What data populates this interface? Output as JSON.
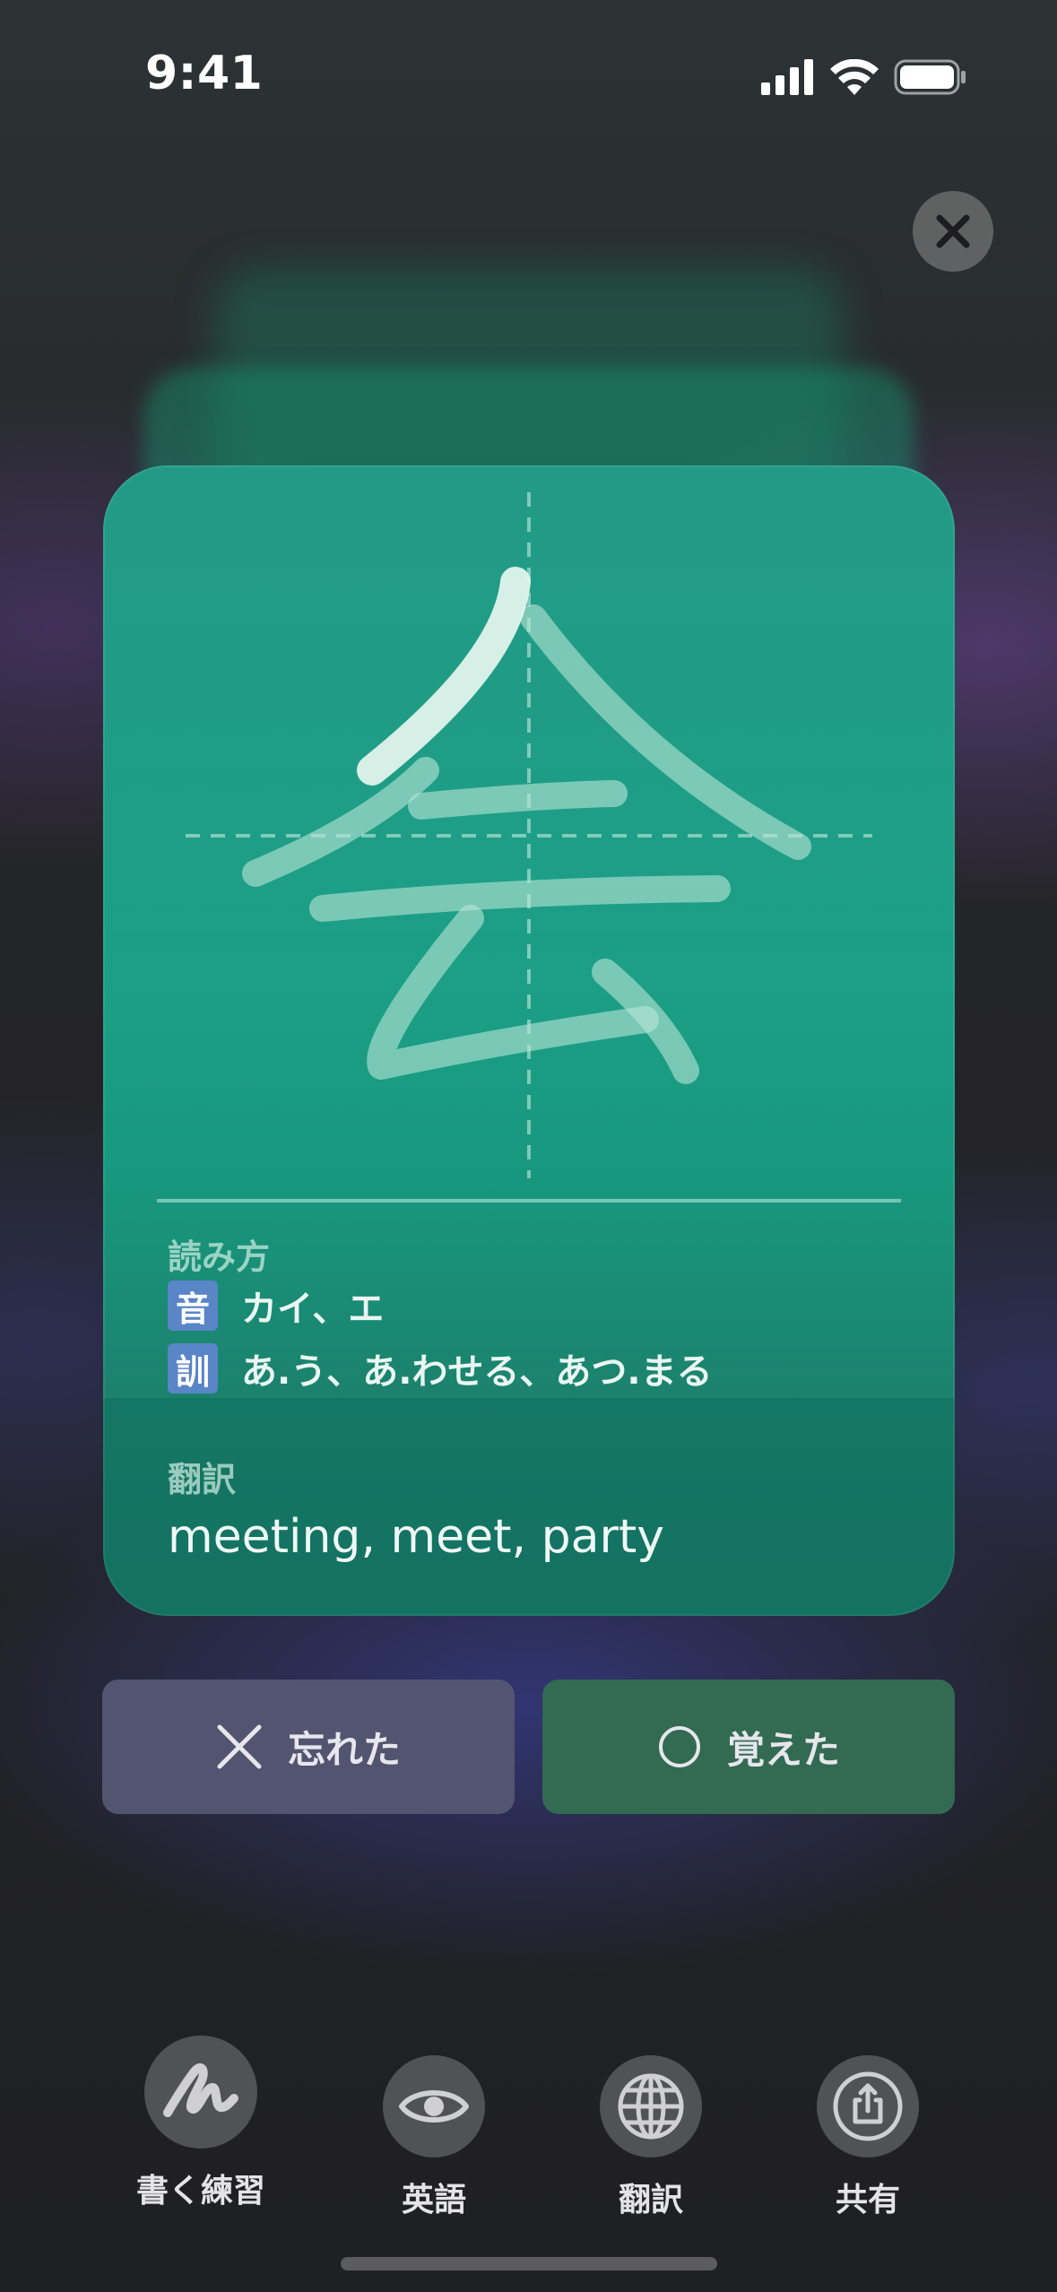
{
  "status_bar": {
    "time": "9:41",
    "icons": [
      "cellular-signal-icon",
      "wifi-icon",
      "battery-icon"
    ]
  },
  "close_button": {
    "icon": "close-icon"
  },
  "card": {
    "kanji": "会",
    "reading_title": "読み方",
    "on_badge": "音",
    "on_reading": "カイ、エ",
    "kun_badge": "訓",
    "kun_reading": "あ.う、あ.わせる、あつ.まる",
    "translation_title": "翻訳",
    "translation": "meeting, meet, party"
  },
  "actions": {
    "forgot_label": "忘れた",
    "forgot_icon": "cross-icon",
    "remembered_label": "覚えた",
    "remembered_icon": "circle-icon"
  },
  "toolbar": [
    {
      "label": "書く練習",
      "icon": "handwriting-icon"
    },
    {
      "label": "英語",
      "icon": "eye-icon"
    },
    {
      "label": "翻訳",
      "icon": "globe-icon"
    },
    {
      "label": "共有",
      "icon": "share-icon"
    }
  ],
  "colors": {
    "card": "#149c82",
    "badge": "#5a85c7",
    "forgot_button": "#535470",
    "remember_button": "#326a52"
  }
}
